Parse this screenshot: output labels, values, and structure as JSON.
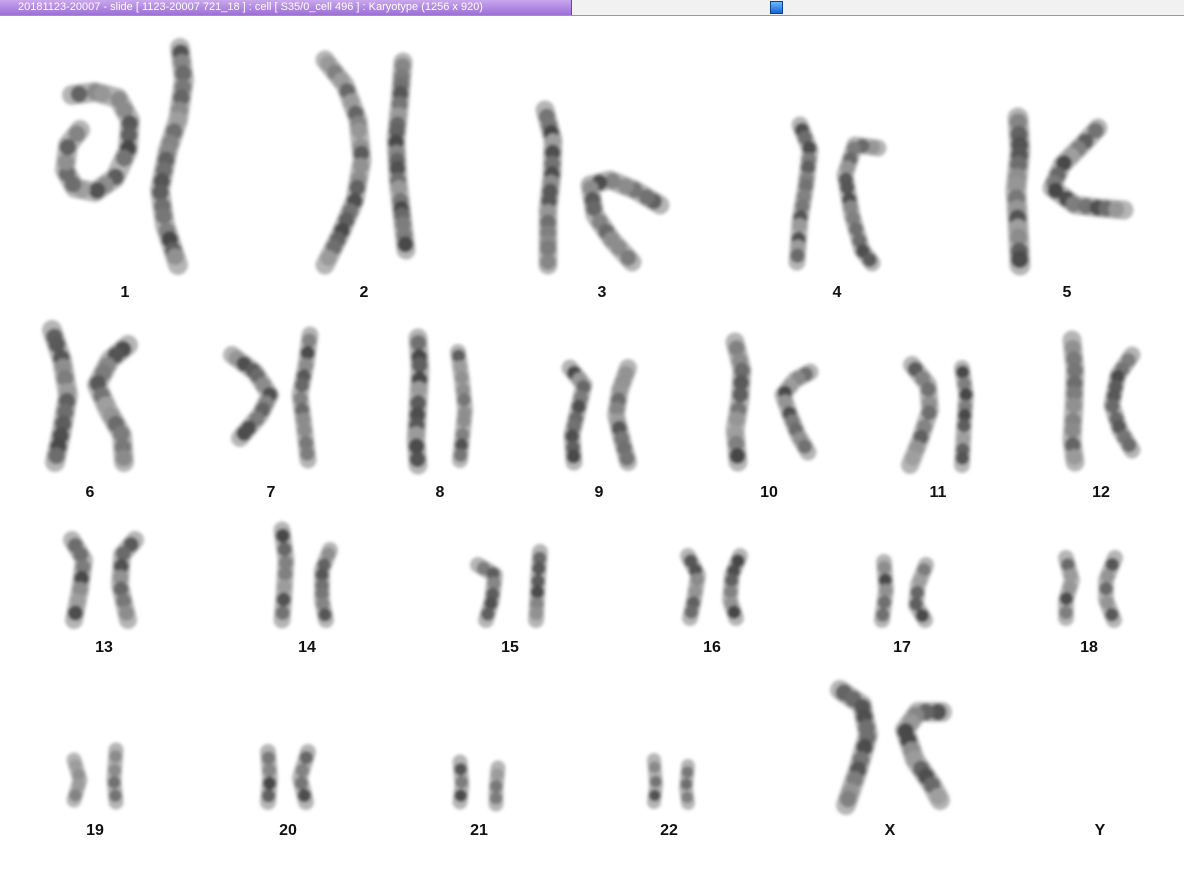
{
  "window": {
    "title": "20181123-20007 - slide [ 1123-20007 721_18 ] : cell [ S35/0_cell 496 ] : Karyotype  (1256 x 920)"
  },
  "karyotype": {
    "labels": [
      "1",
      "2",
      "3",
      "4",
      "5",
      "6",
      "7",
      "8",
      "9",
      "10",
      "11",
      "12",
      "13",
      "14",
      "15",
      "16",
      "17",
      "18",
      "19",
      "20",
      "21",
      "22",
      "X",
      "Y"
    ]
  }
}
